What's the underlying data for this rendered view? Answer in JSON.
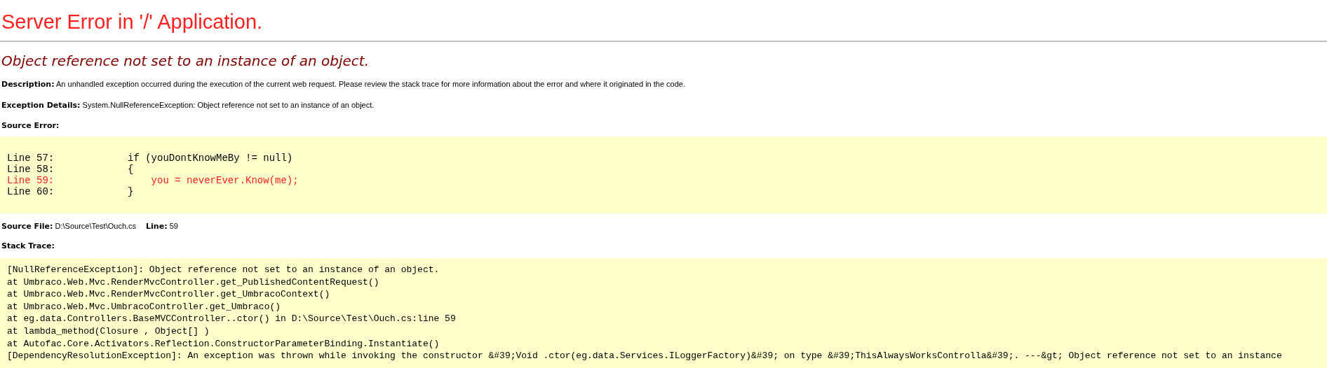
{
  "title": "Server Error in '/' Application.",
  "error_heading": "Object reference not set to an instance of an object.",
  "details": [
    {
      "label": "Description:",
      "text": "An unhandled exception occurred during the execution of the current web request. Please review the stack trace for more information about the error and where it originated in the code."
    },
    {
      "label": "Exception Details:",
      "text": "System.NullReferenceException: Object reference not set to an instance of an object."
    }
  ],
  "source_error": {
    "label": "Source Error:",
    "lines": [
      {
        "number": "Line 57:",
        "code": "if (youDontKnowMeBy != null)",
        "highlighted": false
      },
      {
        "number": "Line 58:",
        "code": "{",
        "highlighted": false
      },
      {
        "number": "Line 59:",
        "code": "    you = neverEver.Know(me);",
        "highlighted": true
      },
      {
        "number": "Line 60:",
        "code": "}",
        "highlighted": false
      }
    ]
  },
  "source_file": {
    "label": "Source File:",
    "value": "D:\\Source\\Test\\Ouch.cs",
    "line_label": "Line:",
    "line_value": "59"
  },
  "stack_trace": {
    "label": "Stack Trace:",
    "lines": [
      "[NullReferenceException]: Object reference not set to an instance of an object.",
      "at Umbraco.Web.Mvc.RenderMvcController.get_PublishedContentRequest()",
      "at Umbraco.Web.Mvc.RenderMvcController.get_UmbracoContext()",
      "at Umbraco.Web.Mvc.UmbracoController.get_Umbraco()",
      "at eg.data.Controllers.BaseMVCController..ctor() in D:\\Source\\Test\\Ouch.cs:line 59",
      "at lambda_method(Closure , Object[] )",
      "at Autofac.Core.Activators.Reflection.ConstructorParameterBinding.Instantiate()",
      "[DependencyResolutionException]: An exception was thrown while invoking the constructor &#39;Void .ctor(eg.data.Services.ILoggerFactory)&#39; on type &#39;ThisAlwaysWorksControlla&#39;. ---&gt; Object reference not set to an instance"
    ]
  }
}
